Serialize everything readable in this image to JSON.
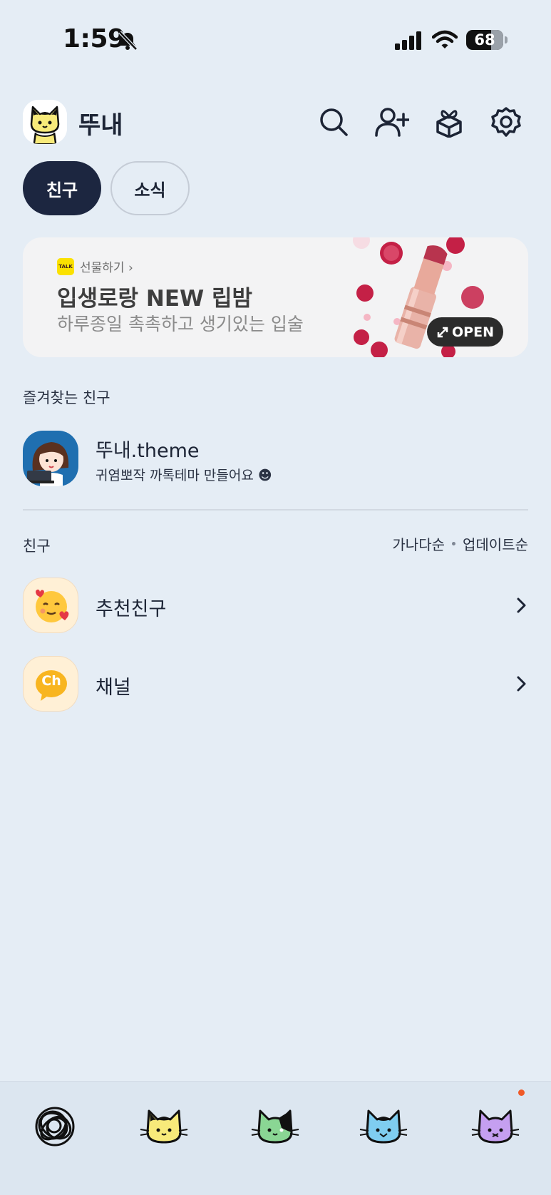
{
  "status_bar": {
    "time": "1:59",
    "battery": "68",
    "battery_level": 0.68
  },
  "header": {
    "profile_name": "뚜내",
    "icons": [
      "search-icon",
      "add-friend-icon",
      "gift-icon",
      "settings-icon"
    ]
  },
  "tabs": [
    {
      "label": "친구",
      "active": true
    },
    {
      "label": "소식",
      "active": false
    }
  ],
  "banner": {
    "gift_label": "선물하기 ›",
    "talk_badge": "TALK",
    "title": "입생로랑 NEW 립밤",
    "subtitle": "하루종일 촉촉하고 생기있는 입술",
    "open_label": "OPEN"
  },
  "favorites": {
    "label": "즐겨찾는 친구",
    "items": [
      {
        "name": "뚜내.theme",
        "status": "귀염뽀작 까톡테마 만들어요 ☻"
      }
    ]
  },
  "friends": {
    "label": "친구",
    "sort_options": [
      "가나다순",
      "업데이트순"
    ],
    "items": [
      {
        "name": "추천친구"
      },
      {
        "name": "채널",
        "badge": "Ch"
      }
    ]
  },
  "bottom_nav": {
    "items": [
      "friends-tab-icon",
      "chats-tab-icon",
      "openchat-tab-icon",
      "shopping-tab-icon",
      "more-tab-icon"
    ],
    "colors": [
      "#111111",
      "#f7ea7a",
      "#8ad694",
      "#7fcdf0",
      "#c59ff0"
    ],
    "notification_color": "#f05a28"
  },
  "colors": {
    "background": "#e5edf5",
    "primary_dark": "#1c2640",
    "kakao_yellow": "#fbe100"
  }
}
